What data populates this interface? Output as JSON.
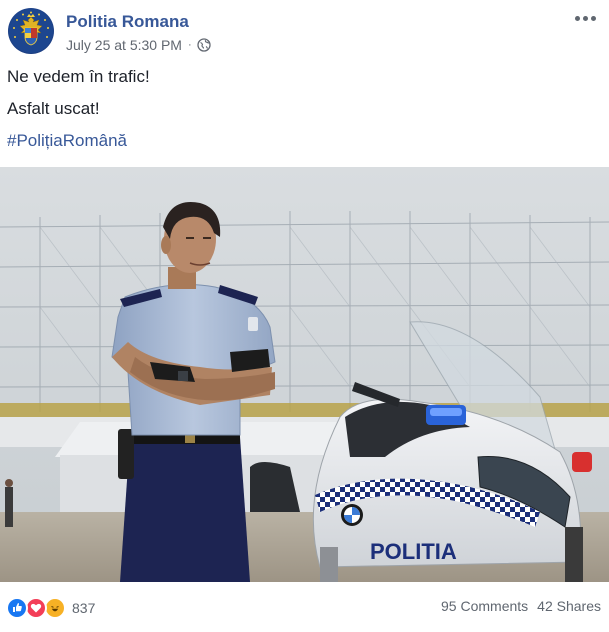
{
  "page": {
    "name": "Politia Romana",
    "timestamp": "July 25 at 5:30 PM",
    "separator": "·",
    "privacy_icon": "globe-icon",
    "avatar_icon": "romanian-coat-of-arms-icon",
    "more_icon": "more-options-icon"
  },
  "post": {
    "lines": [
      "Ne vedem în trafic!",
      "Asfalt uscat!"
    ],
    "hashtag": "#PolițiaRomână"
  },
  "photo": {
    "motorcycle_text": "POLITIA",
    "brand_text": "BMW"
  },
  "footer": {
    "reactions": [
      "like-icon",
      "love-icon",
      "haha-icon"
    ],
    "reaction_count": "837",
    "comments": "95 Comments",
    "shares": "42 Shares"
  },
  "colors": {
    "link": "#385898",
    "text": "#1d2129",
    "meta": "#616770",
    "like": "#1877f2",
    "love": "#f33e58",
    "haha": "#f7b125"
  }
}
